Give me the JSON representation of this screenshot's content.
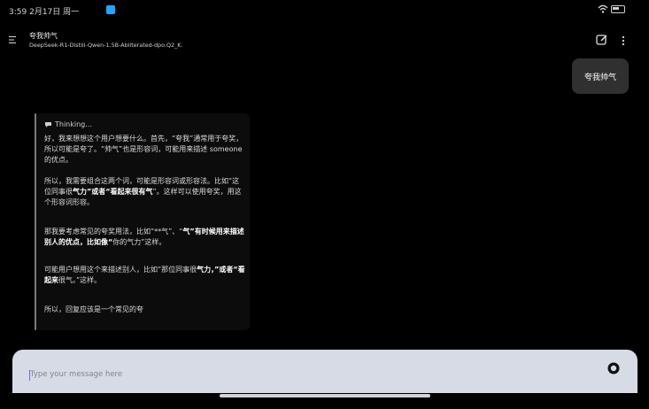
{
  "status_bar": {
    "time": "3:59",
    "date": "2月17日 周一",
    "battery": "51"
  },
  "header": {
    "title": "夸我帅气",
    "model": "DeepSeek-R1-Distill-Qwen-1.5B-Abliterated-dpo.Q2_K."
  },
  "user_message": "夸我帅气",
  "thinking": {
    "label": "Thinking...",
    "paragraphs": [
      {
        "text": "好，我来想想这个用户想要什么。首先，“夸我”通常用于夸奖，所以可能是夸了。“帅气”也是形容词，可能用来描述 someone的优点。"
      },
      {
        "part1": "所以，我需要组合这两个词，可能是形容词或形容法。比如“这位同事很",
        "bold1": "气力”或者“看起来很有气",
        "part2": "”。这样可以使用夸奖，用这个形容词形容。"
      },
      {
        "part1": "那我要考虑常见的夸奖用法，比如“**气”、“",
        "bold1": "气”有时候用来描述别人的优点，比如像“",
        "part2": "你的气力”这样。"
      },
      {
        "part1": "可能用户想用这个来描述别人，比如“那位同事很",
        "bold1": "气力，”或者“看起来",
        "part2": "很气。”这样。"
      },
      {
        "text": "所以，回复应该是一个常见的夸"
      }
    ]
  },
  "composer": {
    "placeholder": "Type your message here",
    "stop_icon": "stop-circle-icon"
  },
  "colors": {
    "background": "#000000",
    "composer_bg": "#d6dbe6",
    "bubble_bg": "#303030",
    "accent": "#1fa6ff"
  }
}
